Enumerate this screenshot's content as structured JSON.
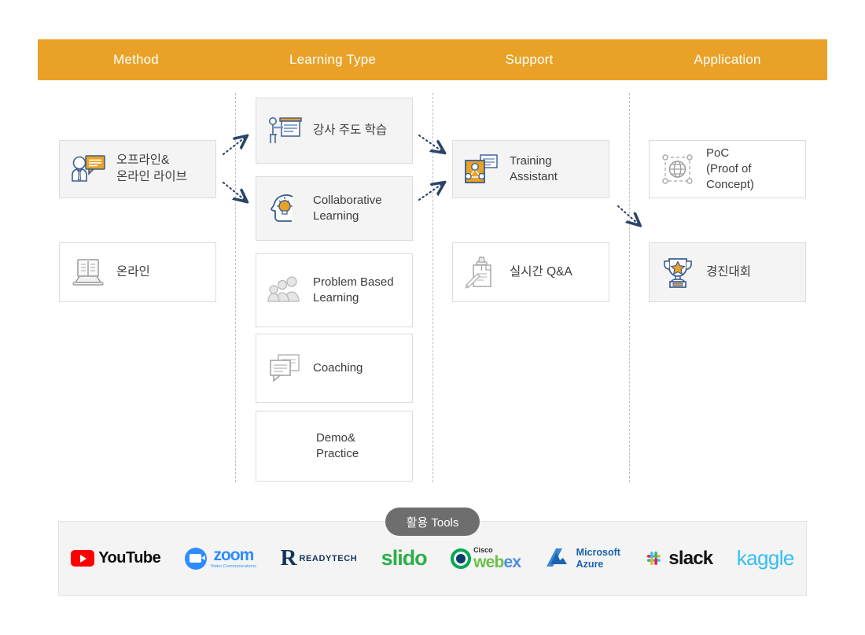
{
  "header": {
    "columns": [
      {
        "label": "Method"
      },
      {
        "label": "Learning Type"
      },
      {
        "label": "Support"
      },
      {
        "label": "Application"
      }
    ],
    "band_color": "#e9a227",
    "text_color": "#ffffff"
  },
  "columns": {
    "method": {
      "cards": [
        {
          "label": "오프라인&\n온라인 라이브",
          "icon": "person-speech-bubble-icon",
          "shaded": true
        },
        {
          "label": "온라인",
          "icon": "laptop-book-icon",
          "shaded": false
        }
      ]
    },
    "learning_type": {
      "cards": [
        {
          "label": "강사 주도 학습",
          "icon": "instructor-whiteboard-icon",
          "shaded": true
        },
        {
          "label": "Collaborative\nLearning",
          "icon": "head-lightbulb-icon",
          "shaded": true
        },
        {
          "label": "Problem Based\nLearning",
          "icon": "group-people-icon",
          "shaded": false
        },
        {
          "label": "Coaching",
          "icon": "speech-documents-icon",
          "shaded": false
        },
        {
          "label": "Demo&\nPractice",
          "icon": "none",
          "shaded": false
        }
      ]
    },
    "support": {
      "cards": [
        {
          "label": "Training\nAssistant",
          "icon": "assistant-network-document-icon",
          "shaded": true
        },
        {
          "label": "실시간 Q&A",
          "icon": "pinned-note-pencil-icon",
          "shaded": false
        }
      ]
    },
    "application": {
      "cards": [
        {
          "label": "PoC\n(Proof of Concept)",
          "icon": "globe-selection-icon",
          "shaded": false
        },
        {
          "label": "경진대회",
          "icon": "trophy-star-icon",
          "shaded": true
        }
      ]
    }
  },
  "flow_arrows": [
    {
      "name": "offline-live-to-instructor-led",
      "direction": "up-right"
    },
    {
      "name": "offline-live-to-collaborative",
      "direction": "down-right"
    },
    {
      "name": "instructor-led-to-training-assistant",
      "direction": "down-right"
    },
    {
      "name": "collaborative-to-training-assistant",
      "direction": "up-right"
    },
    {
      "name": "training-assistant-to-competition",
      "direction": "down-right"
    }
  ],
  "tools": {
    "pill_label": "활용 Tools",
    "pill_color": "#6e6e6e",
    "items": [
      {
        "name": "youtube-logo",
        "label": "YouTube",
        "color": "#ff0000"
      },
      {
        "name": "zoom-logo",
        "label": "zoom",
        "sublabel": "Video Communications",
        "color": "#2d8cff"
      },
      {
        "name": "readytech-logo",
        "label": "READYTECH",
        "mark": "R",
        "color": "#16355c"
      },
      {
        "name": "slido-logo",
        "label": "slido",
        "color": "#2fae4a"
      },
      {
        "name": "webex-logo",
        "label": "webex",
        "sublabel": "Cisco",
        "color": "#6cc04a"
      },
      {
        "name": "microsoft-azure-logo",
        "label_line1": "Microsoft",
        "label_line2": "Azure",
        "color": "#1d62b0"
      },
      {
        "name": "slack-logo",
        "label": "slack",
        "color": "#121212"
      },
      {
        "name": "kaggle-logo",
        "label": "kaggle",
        "color": "#35bef0"
      }
    ]
  }
}
